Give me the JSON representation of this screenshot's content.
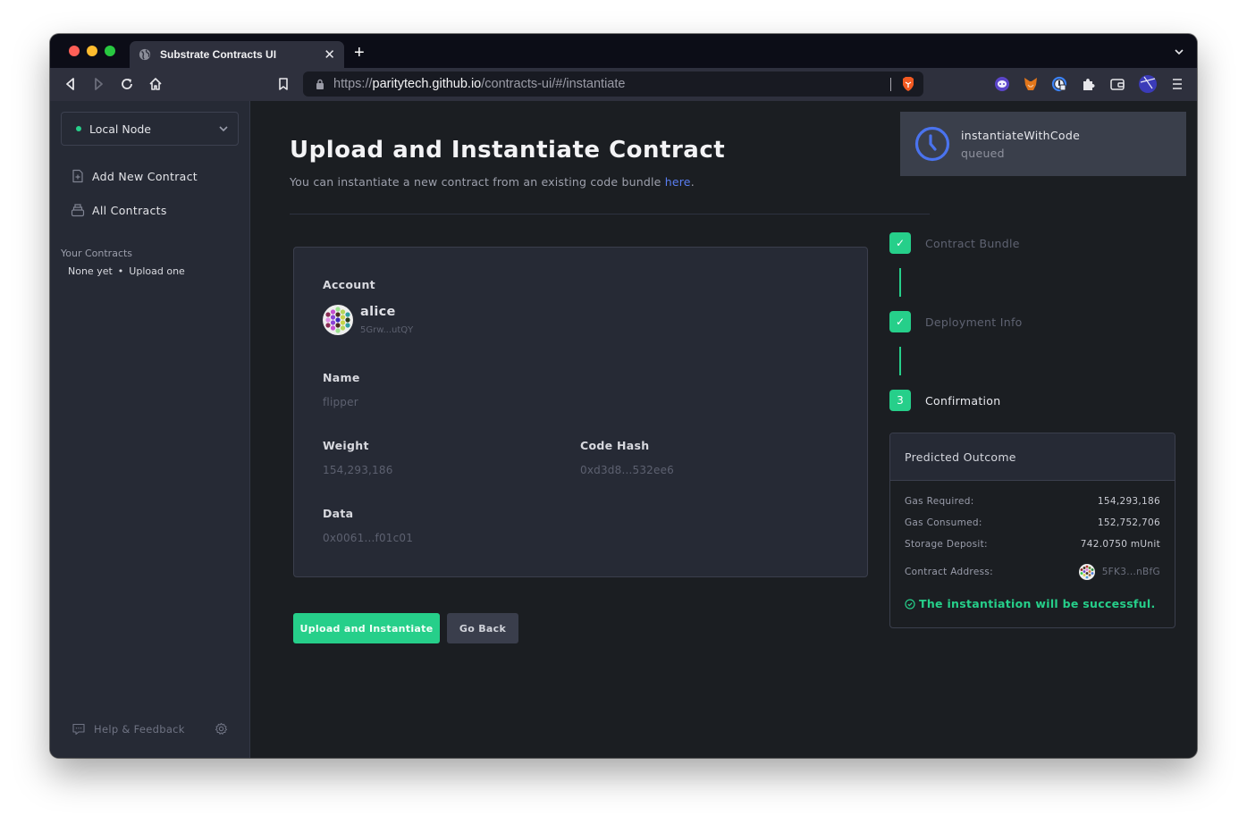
{
  "browser": {
    "tab_title": "Substrate Contracts UI",
    "url_scheme": "https://",
    "url_host": "paritytech.github.io",
    "url_path": "/contracts-ui/#/instantiate",
    "extensions": [
      "polkadot-js-icon",
      "metamask-icon",
      "password-manager-icon",
      "puzzle-extensions-icon",
      "wallet-icon",
      "profile-icon",
      "hamburger-menu-icon"
    ]
  },
  "sidebar": {
    "node_select": "Local Node",
    "nav": [
      {
        "label": "Add New Contract",
        "icon": "file-plus-icon"
      },
      {
        "label": "All Contracts",
        "icon": "stack-icon"
      }
    ],
    "your_contracts_label": "Your Contracts",
    "none_yet": "None yet",
    "bullet": "•",
    "upload_one": "Upload one",
    "help_label": "Help & Feedback"
  },
  "page": {
    "title": "Upload and Instantiate Contract",
    "subtitle": "You can instantiate a new contract from an existing code bundle ",
    "subtitle_link": "here",
    "subtitle_end": "."
  },
  "form": {
    "account_label": "Account",
    "account_name": "alice",
    "account_address": "5Grw...utQY",
    "name_label": "Name",
    "name_value": "flipper",
    "weight_label": "Weight",
    "weight_value": "154,293,186",
    "code_hash_label": "Code Hash",
    "code_hash_value": "0xd3d8...532ee6",
    "data_label": "Data",
    "data_value": "0x0061...f01c01"
  },
  "actions": {
    "primary": "Upload and Instantiate",
    "secondary": "Go Back"
  },
  "toast": {
    "title": "instantiateWithCode",
    "status": "queued"
  },
  "steps": [
    {
      "label": "Contract Bundle",
      "state": "done",
      "marker": "✓"
    },
    {
      "label": "Deployment Info",
      "state": "done",
      "marker": "✓"
    },
    {
      "label": "Confirmation",
      "state": "active",
      "marker": "3"
    }
  ],
  "outcome": {
    "title": "Predicted Outcome",
    "gas_required_label": "Gas Required:",
    "gas_required": "154,293,186",
    "gas_consumed_label": "Gas Consumed:",
    "gas_consumed": "152,752,706",
    "storage_deposit_label": "Storage Deposit:",
    "storage_deposit": "742.0750 mUnit",
    "contract_address_label": "Contract Address:",
    "contract_address": "5FK3...nBfG",
    "success_message": "The instantiation will be successful."
  },
  "colors": {
    "accent_green": "#26cf8a",
    "link_blue": "#5a7ef2",
    "toast_clock_blue": "#4a73ee"
  }
}
